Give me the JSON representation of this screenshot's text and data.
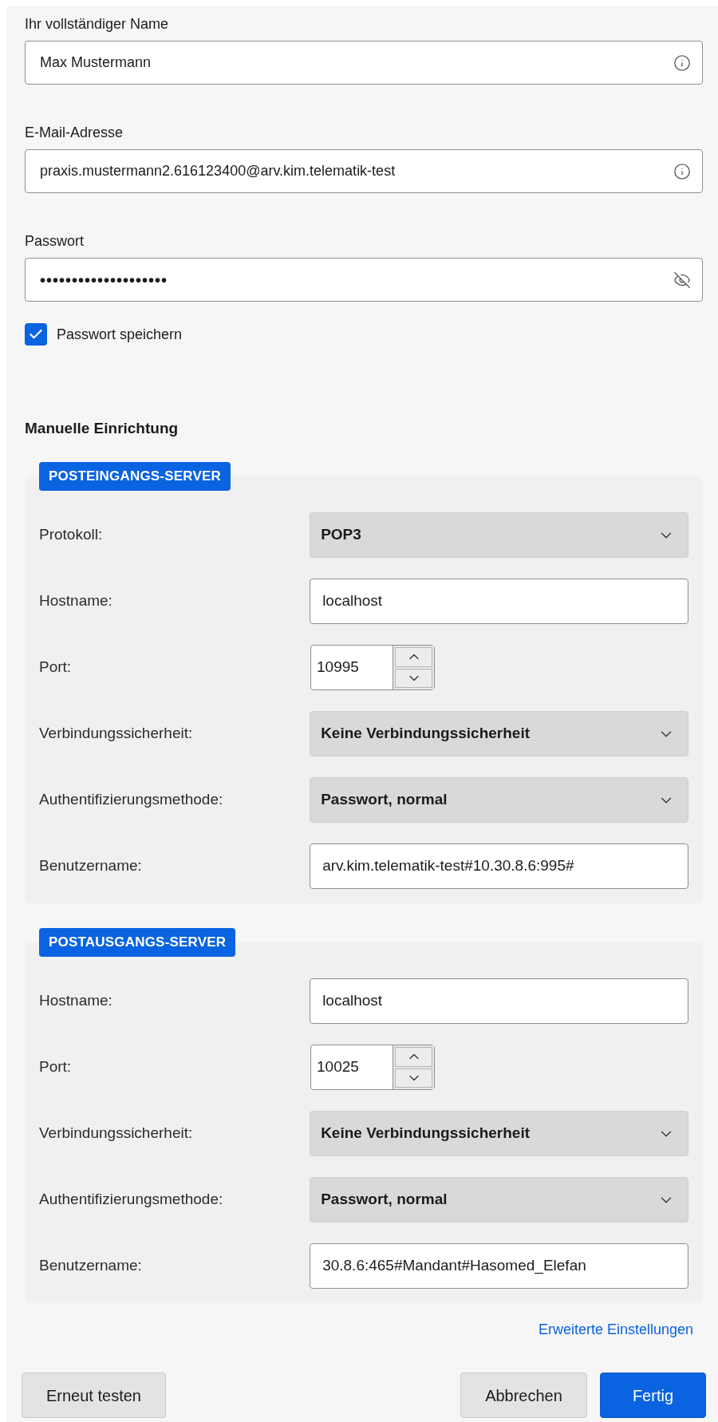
{
  "account_fields": [
    {
      "label": "Ihr vollständiger Name",
      "value": "Max Mustermann",
      "kind": "text"
    },
    {
      "label": "E-Mail-Adresse",
      "value": "praxis.mustermann2.616123400@arv.kim.telematik-test",
      "kind": "text"
    },
    {
      "label": "Passwort",
      "value": "••••••••••••••••••••",
      "kind": "password"
    }
  ],
  "remember_password": {
    "label": "Passwort speichern",
    "checked": true
  },
  "manual_setup": {
    "title": "Manuelle Einrichtung",
    "sections": [
      {
        "badge": "POSTEINGANGS-SERVER",
        "rows": [
          {
            "label": "Protokoll:",
            "kind": "select",
            "value": "POP3"
          },
          {
            "label": "Hostname:",
            "kind": "text",
            "value": "localhost"
          },
          {
            "label": "Port:",
            "kind": "spinner",
            "value": "10995"
          },
          {
            "label": "Verbindungssicherheit:",
            "kind": "select",
            "value": "Keine Verbindungssicherheit"
          },
          {
            "label": "Authentifizierungsmethode:",
            "kind": "select",
            "value": "Passwort, normal"
          },
          {
            "label": "Benutzername:",
            "kind": "text",
            "value": "arv.kim.telematik-test#10.30.8.6:995#"
          }
        ]
      },
      {
        "badge": "POSTAUSGANGS-SERVER",
        "rows": [
          {
            "label": "Hostname:",
            "kind": "text",
            "value": "localhost"
          },
          {
            "label": "Port:",
            "kind": "spinner",
            "value": "10025"
          },
          {
            "label": "Verbindungssicherheit:",
            "kind": "select",
            "value": "Keine Verbindungssicherheit"
          },
          {
            "label": "Authentifizierungsmethode:",
            "kind": "select",
            "value": "Passwort, normal"
          },
          {
            "label": "Benutzername:",
            "kind": "text",
            "value": "30.8.6:465#Mandant#Hasomed_Elefan"
          }
        ]
      }
    ]
  },
  "advanced_link": "Erweiterte Einstellungen",
  "left_buttons": [
    {
      "label": "Erneut testen",
      "primary": false
    }
  ],
  "right_buttons": [
    {
      "label": "Abbrechen",
      "primary": false
    },
    {
      "label": "Fertig",
      "primary": true
    }
  ]
}
